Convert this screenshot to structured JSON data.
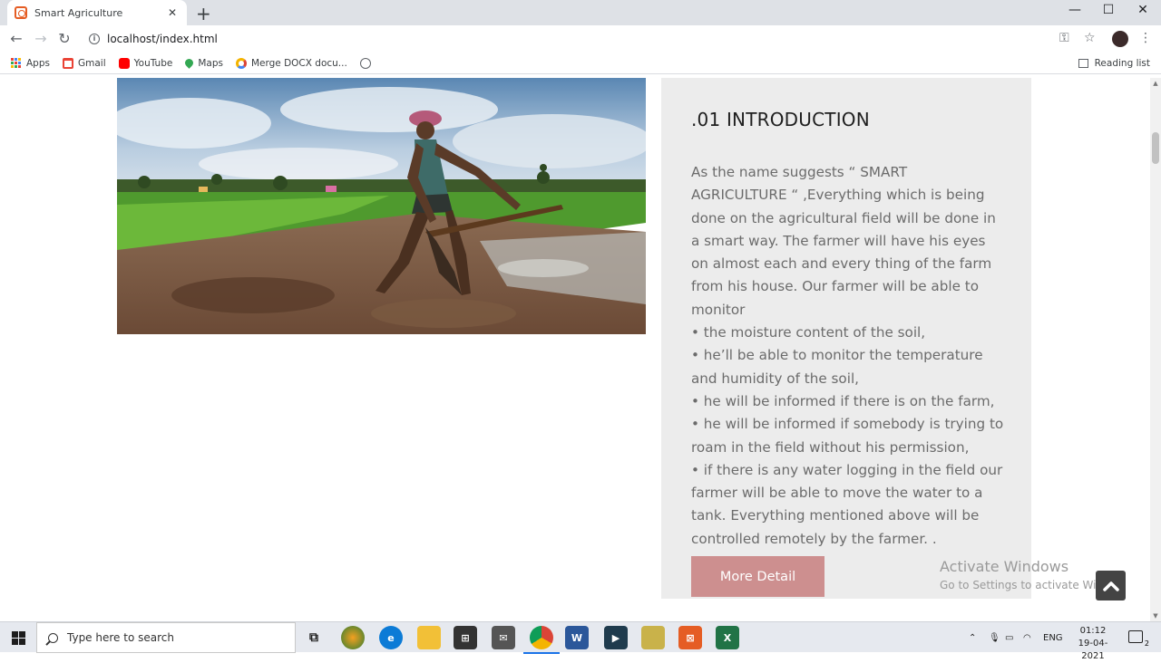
{
  "browser": {
    "tab_title": "Smart Agriculture",
    "tab_close": "✕",
    "new_tab": "+",
    "url": "localhost/index.html",
    "window_controls": {
      "minimize": "—",
      "maximize": "☐",
      "close": "✕"
    }
  },
  "bookmarks": {
    "items": [
      {
        "label": "Apps",
        "icon": "apps-grid-icon"
      },
      {
        "label": "Gmail",
        "icon": "gmail-icon",
        "color": "#ea4335"
      },
      {
        "label": "YouTube",
        "icon": "youtube-icon",
        "color": "#ff0000"
      },
      {
        "label": "Maps",
        "icon": "maps-pin-icon",
        "color": "#34a853"
      },
      {
        "label": "Merge DOCX docu...",
        "icon": "merge-docx-icon",
        "color": "#f4b400"
      }
    ],
    "reading_list": "Reading list"
  },
  "page": {
    "section_title": ".01 INTRODUCTION",
    "paragraphs": [
      "As the name suggests “ SMART AGRICULTURE “ ,Everything which is being done on the agricultural field will be done in a smart way. The farmer will have his eyes on almost each and every thing of the farm from his house. Our farmer will be able to monitor",
      "• the moisture content of the soil,",
      "• he’ll be able to monitor the temperature and humidity of the soil,",
      "• he will be informed if there is on the farm,",
      "• he will be informed if somebody is trying to roam in the field without his permission,",
      "• if there is any water logging in the field our farmer will be able to move the water to a tank. Everything mentioned above will be controlled remotely by the farmer. ."
    ],
    "more_button": "More Detail",
    "accent_color": "#cd8f8f"
  },
  "watermark": {
    "line1": "Activate Windows",
    "line2": "Go to Settings to activate Windo"
  },
  "taskbar": {
    "search_placeholder": "Type here to search",
    "apps": [
      "task-view",
      "mango-app",
      "edge",
      "file-explorer",
      "store",
      "mail",
      "chrome",
      "word",
      "app-launcher",
      "file-manager",
      "xampp",
      "excel"
    ],
    "tray_lang": "ENG",
    "time": "01:12",
    "date": "19-04-2021",
    "notifications": "2"
  }
}
